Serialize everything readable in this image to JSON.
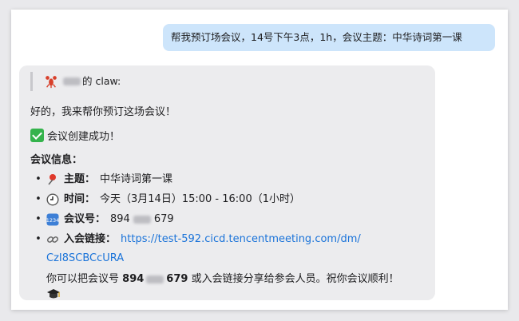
{
  "conversation": {
    "user_message": "帮我预订场会议，14号下午3点，1h，会议主题：中华诗词第一课",
    "bot": {
      "quote_suffix": "的 claw:",
      "intro": "好的，我来帮你预订这场会议！",
      "success": "会议创建成功！",
      "info_heading": "会议信息：",
      "items": [
        {
          "icon": "pushpin-icon",
          "label": "主题：",
          "value": "中华诗词第一课"
        },
        {
          "icon": "clock-icon",
          "label": "时间：",
          "value": "今天（3月14日）15:00 - 16:00（1小时）"
        },
        {
          "icon": "numbers-icon",
          "label": "会议号：",
          "value_prefix": "894",
          "value_suffix": "679"
        },
        {
          "icon": "link-icon",
          "label": "入会链接：",
          "link_line1": "https://test-592.cicd.tencentmeeting.com/dm/",
          "link_line2": "CzI8SCBCcURA"
        }
      ],
      "footer_1": "你可以把会议号",
      "footer_num_prefix": "894",
      "footer_num_suffix": "679",
      "footer_2": "或入会链接分享给参会人员。祝你会议顺利！"
    }
  },
  "colors": {
    "user_bubble": "#cde5fb",
    "bot_bubble": "#ececee",
    "link": "#1a73d9",
    "check": "#34b34c"
  }
}
